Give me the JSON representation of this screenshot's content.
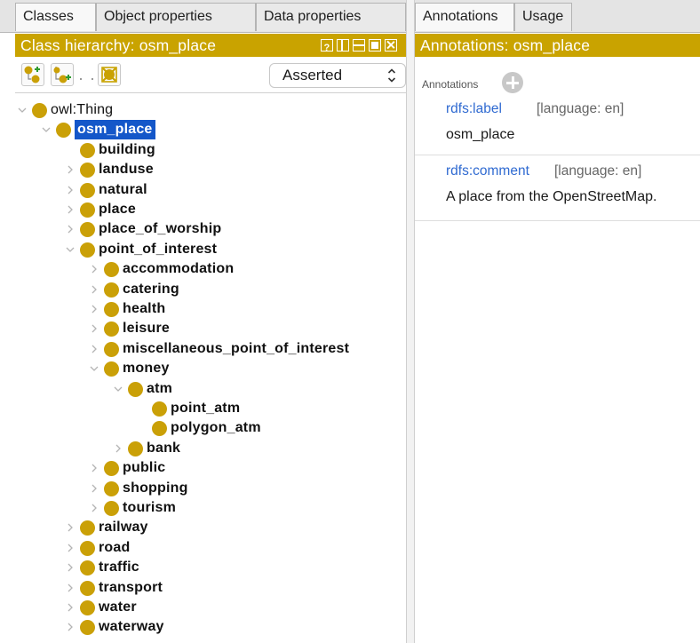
{
  "left_tabs": [
    "Classes",
    "Object properties",
    "Data properties"
  ],
  "class_view": {
    "title": "Class hierarchy: osm_place",
    "mode_select": "Asserted",
    "toolbar_icons": [
      "add-subclass-icon",
      "add-sibling-class-icon",
      "delete-class-icon"
    ]
  },
  "tree": [
    {
      "label": "owl:Thing",
      "depth": 0,
      "expanded": true,
      "bold": false
    },
    {
      "label": "osm_place",
      "depth": 1,
      "expanded": true,
      "selected": true
    },
    {
      "label": "building",
      "depth": 2,
      "expanded": null
    },
    {
      "label": "landuse",
      "depth": 2,
      "expanded": false
    },
    {
      "label": "natural",
      "depth": 2,
      "expanded": false
    },
    {
      "label": "place",
      "depth": 2,
      "expanded": false
    },
    {
      "label": "place_of_worship",
      "depth": 2,
      "expanded": false
    },
    {
      "label": "point_of_interest",
      "depth": 2,
      "expanded": true
    },
    {
      "label": "accommodation",
      "depth": 3,
      "expanded": false
    },
    {
      "label": "catering",
      "depth": 3,
      "expanded": false
    },
    {
      "label": "health",
      "depth": 3,
      "expanded": false
    },
    {
      "label": "leisure",
      "depth": 3,
      "expanded": false
    },
    {
      "label": "miscellaneous_point_of_interest",
      "depth": 3,
      "expanded": false
    },
    {
      "label": "money",
      "depth": 3,
      "expanded": true
    },
    {
      "label": "atm",
      "depth": 4,
      "expanded": true
    },
    {
      "label": "point_atm",
      "depth": 5,
      "expanded": null
    },
    {
      "label": "polygon_atm",
      "depth": 5,
      "expanded": null
    },
    {
      "label": "bank",
      "depth": 4,
      "expanded": false
    },
    {
      "label": "public",
      "depth": 3,
      "expanded": false
    },
    {
      "label": "shopping",
      "depth": 3,
      "expanded": false
    },
    {
      "label": "tourism",
      "depth": 3,
      "expanded": false
    },
    {
      "label": "railway",
      "depth": 2,
      "expanded": false
    },
    {
      "label": "road",
      "depth": 2,
      "expanded": false
    },
    {
      "label": "traffic",
      "depth": 2,
      "expanded": false
    },
    {
      "label": "transport",
      "depth": 2,
      "expanded": false
    },
    {
      "label": "water",
      "depth": 2,
      "expanded": false
    },
    {
      "label": "waterway",
      "depth": 2,
      "expanded": false
    }
  ],
  "right_tabs": [
    "Annotations",
    "Usage"
  ],
  "annotations_view": {
    "title": "Annotations: osm_place",
    "header": "Annotations",
    "items": [
      {
        "property": "rdfs:label",
        "language": "[language: en]",
        "value": "osm_place"
      },
      {
        "property": "rdfs:comment",
        "language": "[language: en]",
        "value": "A place from the OpenStreetMap."
      }
    ]
  },
  "colors": {
    "view_header": "#c9a300",
    "class_bullet": "#caa007",
    "selection": "#1457c9",
    "annotation_property": "#2f6ad1"
  }
}
